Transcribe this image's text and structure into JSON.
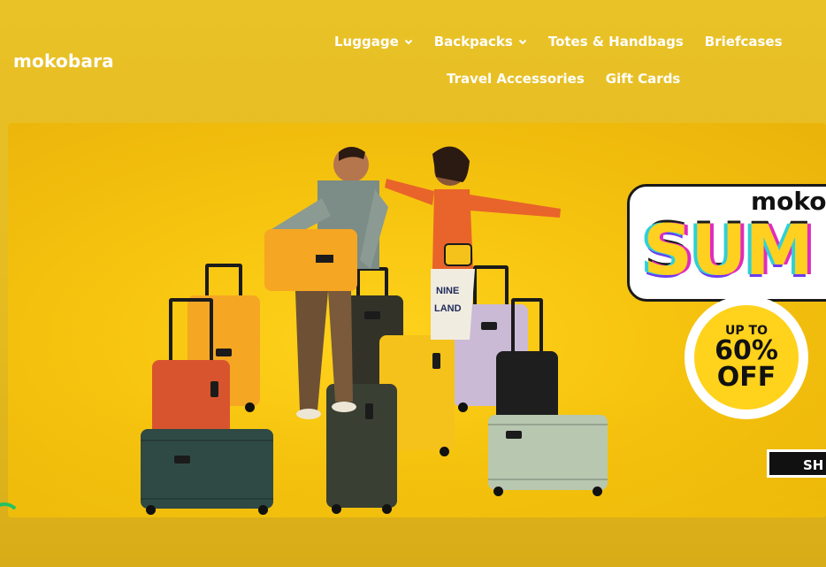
{
  "brand": {
    "logo_text": "mokobara"
  },
  "nav": {
    "row1": [
      {
        "label": "Luggage",
        "has_dropdown": true
      },
      {
        "label": "Backpacks",
        "has_dropdown": true
      },
      {
        "label": "Totes & Handbags",
        "has_dropdown": false
      },
      {
        "label": "Briefcases",
        "has_dropdown": false
      }
    ],
    "row2": [
      {
        "label": "Travel Accessories",
        "has_dropdown": false
      },
      {
        "label": "Gift Cards",
        "has_dropdown": false
      }
    ]
  },
  "banner": {
    "promo_brand": "moko",
    "promo_title": "SUM",
    "offer_prefix": "UP TO",
    "offer_value": "60%",
    "offer_suffix": "OFF",
    "cta_label": "SH"
  },
  "colors": {
    "page_bg": "#e6b920",
    "banner_bg": "#f6c40f",
    "nav_text": "#ffffff",
    "cta_bg": "#111111"
  }
}
